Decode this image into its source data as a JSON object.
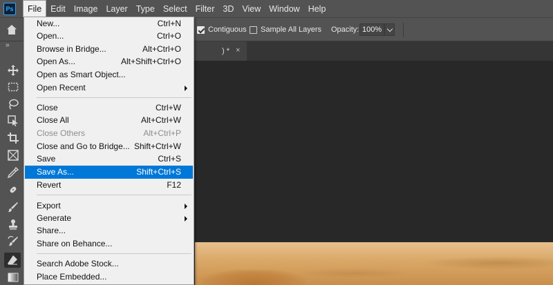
{
  "app": {
    "logo": "Ps",
    "menu": [
      "File",
      "Edit",
      "Image",
      "Layer",
      "Type",
      "Select",
      "Filter",
      "3D",
      "View",
      "Window",
      "Help"
    ],
    "active_menu": "File"
  },
  "options_bar": {
    "contiguous_label": "Contiguous",
    "contiguous_checked": true,
    "sample_all_layers_label": "Sample All Layers",
    "sample_all_layers_checked": false,
    "opacity_label": "Opacity:",
    "opacity_value": "100%"
  },
  "toolbar": {
    "collapse_glyph": "»",
    "tools": [
      "move-icon",
      "marquee-icon",
      "lasso-icon",
      "object-select-icon",
      "crop-icon",
      "frame-icon",
      "eyedropper-icon",
      "healing-icon",
      "brush-icon",
      "stamp-icon",
      "history-brush-icon",
      "eraser-icon",
      "gradient-icon"
    ]
  },
  "document_tab": {
    "label": ") *",
    "close": "×"
  },
  "file_menu": {
    "items": [
      {
        "label": "New...",
        "shortcut": "Ctrl+N"
      },
      {
        "label": "Open...",
        "shortcut": "Ctrl+O"
      },
      {
        "label": "Browse in Bridge...",
        "shortcut": "Alt+Ctrl+O"
      },
      {
        "label": "Open As...",
        "shortcut": "Alt+Shift+Ctrl+O"
      },
      {
        "label": "Open as Smart Object...",
        "shortcut": ""
      },
      {
        "label": "Open Recent",
        "shortcut": "",
        "submenu": true
      },
      {
        "label": "Close",
        "shortcut": "Ctrl+W"
      },
      {
        "label": "Close All",
        "shortcut": "Alt+Ctrl+W"
      },
      {
        "label": "Close Others",
        "shortcut": "Alt+Ctrl+P",
        "disabled": true
      },
      {
        "label": "Close and Go to Bridge...",
        "shortcut": "Shift+Ctrl+W"
      },
      {
        "label": "Save",
        "shortcut": "Ctrl+S"
      },
      {
        "label": "Save As...",
        "shortcut": "Shift+Ctrl+S",
        "highlighted": true
      },
      {
        "label": "Revert",
        "shortcut": "F12"
      },
      {
        "label": "Export",
        "shortcut": "",
        "submenu": true
      },
      {
        "label": "Generate",
        "shortcut": "",
        "submenu": true
      },
      {
        "label": "Share...",
        "shortcut": ""
      },
      {
        "label": "Share on Behance...",
        "shortcut": ""
      },
      {
        "label": "Search Adobe Stock...",
        "shortcut": ""
      },
      {
        "label": "Place Embedded...",
        "shortcut": ""
      }
    ]
  },
  "colors": {
    "menubar_bg": "#535353",
    "canvas_bg": "#282828",
    "menu_bg": "#f0f0f0",
    "highlight": "#0078d7"
  }
}
